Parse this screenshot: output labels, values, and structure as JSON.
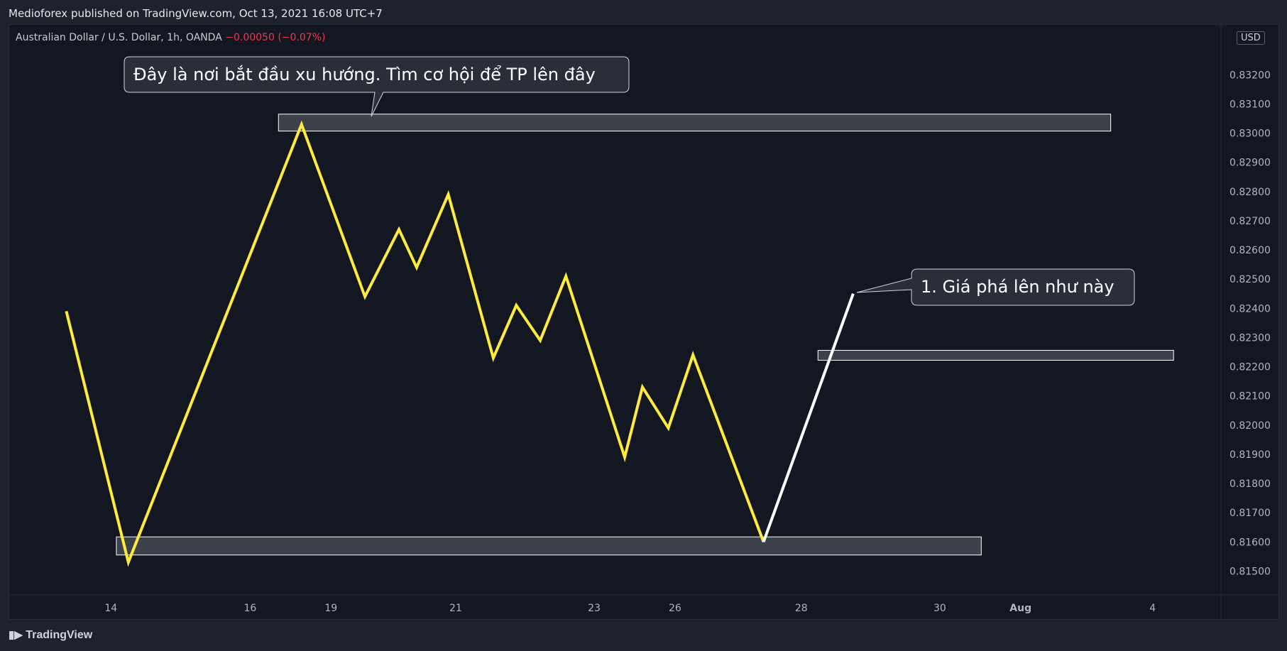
{
  "header": {
    "publisher": "Medioforex published on TradingView.com, Oct 13, 2021 16:08 UTC+7"
  },
  "legend": {
    "symbol": "Australian Dollar / U.S. Dollar, 1h, OANDA",
    "change": "−0.00050 (−0.07%)"
  },
  "price_axis": {
    "currency": "USD"
  },
  "footer": {
    "brand": "TradingView"
  },
  "colors": {
    "background": "#131722",
    "series": "#ffeb3b",
    "projection": "#ffffff",
    "zone": "#434651",
    "change": "#f23645"
  },
  "chart_data": {
    "type": "line",
    "title": "Australian Dollar / U.S. Dollar, 1h, OANDA",
    "xlabel": "",
    "ylabel": "",
    "ylim": [
      0.8145,
      0.8335
    ],
    "y_ticks": [
      0.815,
      0.816,
      0.817,
      0.818,
      0.819,
      0.82,
      0.821,
      0.822,
      0.823,
      0.824,
      0.825,
      0.826,
      0.827,
      0.828,
      0.829,
      0.83,
      0.831,
      0.832
    ],
    "y_tick_labels": [
      "0.81500",
      "0.81600",
      "0.81700",
      "0.81800",
      "0.81900",
      "0.82000",
      "0.82100",
      "0.82200",
      "0.82300",
      "0.82400",
      "0.82500",
      "0.82600",
      "0.82700",
      "0.82800",
      "0.82900",
      "0.83000",
      "0.83100",
      "0.83200"
    ],
    "xlim": [
      0,
      1000
    ],
    "x_ticks": [
      {
        "x": 83.5,
        "label": "14"
      },
      {
        "x": 198.6,
        "label": "16"
      },
      {
        "x": 265.4,
        "label": "19"
      },
      {
        "x": 368.5,
        "label": "21"
      },
      {
        "x": 483.0,
        "label": "23"
      },
      {
        "x": 549.8,
        "label": "26"
      },
      {
        "x": 654.2,
        "label": "28"
      },
      {
        "x": 768.7,
        "label": "30"
      },
      {
        "x": 835.5,
        "label": "Aug"
      },
      {
        "x": 944.7,
        "label": "4"
      }
    ],
    "series": [
      {
        "color": "#ffeb3b",
        "points": [
          [
            46.6,
            0.8239
          ],
          [
            97.9,
            0.8153
          ],
          [
            241.1,
            0.8303
          ],
          [
            293.5,
            0.8244
          ],
          [
            321.6,
            0.8267
          ],
          [
            336.2,
            0.8254
          ],
          [
            362.4,
            0.8279
          ],
          [
            399.6,
            0.8223
          ],
          [
            418.6,
            0.8241
          ],
          [
            438.4,
            0.8229
          ],
          [
            459.6,
            0.8251
          ],
          [
            508.2,
            0.8189
          ],
          [
            522.9,
            0.8213
          ],
          [
            544.3,
            0.8199
          ],
          [
            564.7,
            0.8224
          ],
          [
            623.0,
            0.816
          ]
        ]
      },
      {
        "color": "#ffffff",
        "points": [
          [
            623.0,
            0.816
          ],
          [
            697.1,
            0.8245
          ]
        ]
      }
    ],
    "zones": [
      {
        "x0": 222.0,
        "x1": 910.0,
        "y0": 0.83007,
        "y1": 0.83065
      },
      {
        "x0": 668.0,
        "x1": 962.0,
        "y0": 0.82222,
        "y1": 0.82256
      },
      {
        "x0": 88.0,
        "x1": 803.0,
        "y0": 0.81555,
        "y1": 0.81617
      }
    ],
    "annotations": [
      {
        "text": "Đây là nơi bắt đầu xu hướng. Tìm cơ hội để TP lên đây",
        "anchor_x": 296.6,
        "anchor_y": 0.83055
      },
      {
        "text": "1. Giá phá lên như này",
        "anchor_x": 697.1,
        "anchor_y": 0.8245
      }
    ]
  }
}
